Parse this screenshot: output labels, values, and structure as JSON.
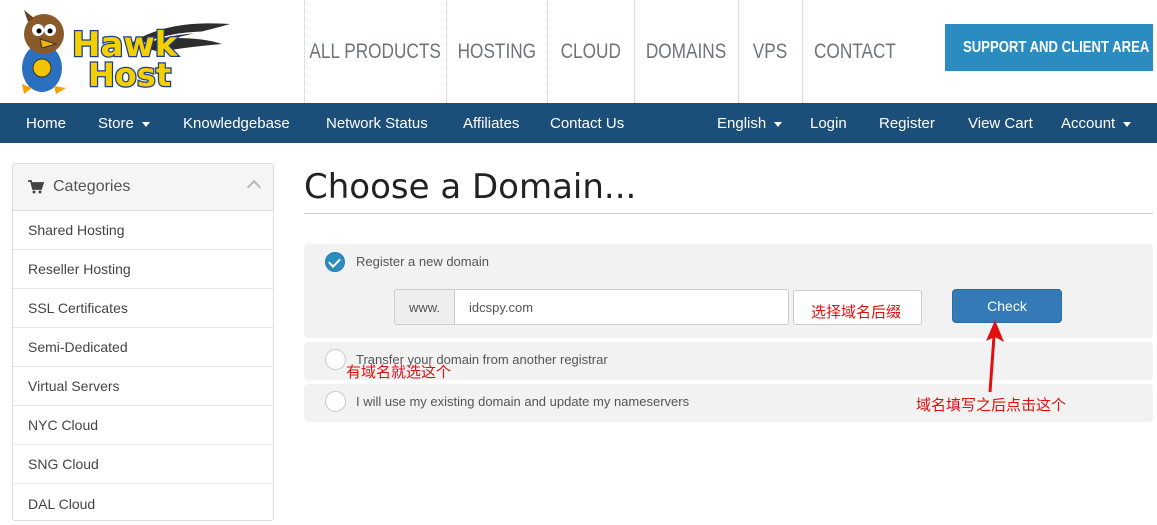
{
  "logo": {
    "text_top": "Hawk",
    "text_bottom": "Host"
  },
  "top_nav": {
    "items": [
      {
        "label": "ALL PRODUCTS"
      },
      {
        "label": "HOSTING"
      },
      {
        "label": "CLOUD"
      },
      {
        "label": "DOMAINS"
      },
      {
        "label": "VPS"
      },
      {
        "label": "CONTACT"
      }
    ],
    "support_button": "SUPPORT AND CLIENT AREA"
  },
  "navbar": {
    "left": {
      "home": "Home",
      "store": "Store",
      "knowledgebase": "Knowledgebase",
      "network_status": "Network Status",
      "affiliates": "Affiliates",
      "contact_us": "Contact Us"
    },
    "right": {
      "language": "English",
      "login": "Login",
      "register": "Register",
      "view_cart": "View Cart",
      "account": "Account"
    }
  },
  "sidebar": {
    "title": "Categories",
    "items": [
      "Shared Hosting",
      "Reseller Hosting",
      "SSL Certificates",
      "Semi-Dedicated",
      "Virtual Servers",
      "NYC Cloud",
      "SNG Cloud",
      "DAL Cloud"
    ]
  },
  "main": {
    "title": "Choose a Domain...",
    "option_register": "Register a new domain",
    "www_prefix": "www.",
    "domain_value": "idcspy.com",
    "check_button": "Check",
    "option_transfer": "Transfer your domain from another registrar",
    "option_existing": "I will use my existing domain and update my nameservers"
  },
  "annotations": {
    "tld_hint": "选择域名后缀",
    "existing_hint": "有域名就选这个",
    "check_hint": "域名填写之后点击这个"
  },
  "colors": {
    "navbar": "#1c4e7a",
    "support_button": "#2a8cc0",
    "check_button": "#337ab7",
    "annotation_red": "#e01010"
  }
}
